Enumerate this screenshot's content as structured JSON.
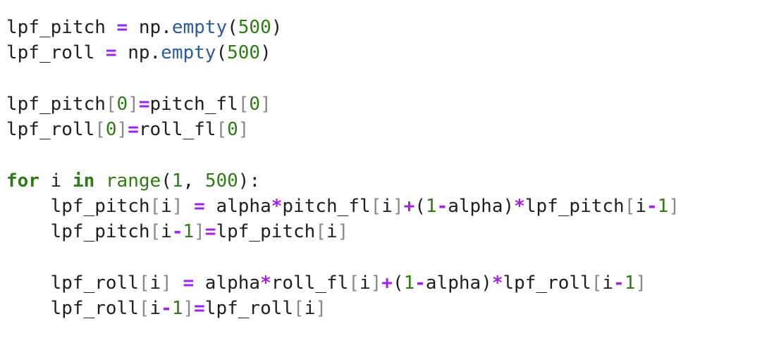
{
  "code": {
    "language": "python",
    "lines": [
      "lpf_pitch = np.empty(500)",
      "lpf_roll = np.empty(500)",
      "",
      "lpf_pitch[0]=pitch_fl[0]",
      "lpf_roll[0]=roll_fl[0]",
      "",
      "for i in range(1, 500):",
      "    lpf_pitch[i] = alpha*pitch_fl[i]+(1-alpha)*lpf_pitch[i-1]",
      "    lpf_pitch[i-1]=lpf_pitch[i]",
      "",
      "    lpf_roll[i] = alpha*roll_fl[i]+(1-alpha)*lpf_roll[i-1]",
      "    lpf_roll[i-1]=lpf_roll[i]"
    ]
  },
  "colors": {
    "text": "#1f1f1f",
    "operator": "#a020f0",
    "number": "#2e7d14",
    "keyword": "#2e7d14",
    "builtin": "#2c5aa0",
    "bracket": "#8a8a8a",
    "background": "#ffffff"
  }
}
